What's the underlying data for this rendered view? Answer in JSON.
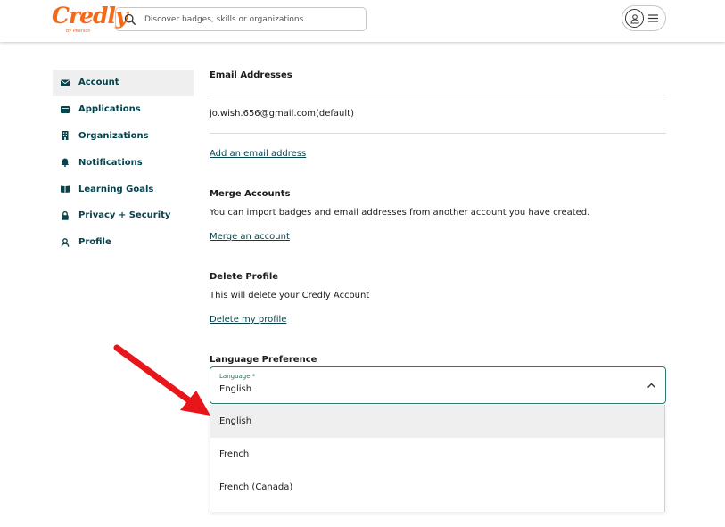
{
  "header": {
    "logo_text": "Credly",
    "logo_sub": "by Pearson",
    "search_placeholder": "Discover badges, skills or organizations"
  },
  "sidebar": {
    "items": [
      {
        "label": "Account",
        "icon": "envelope-icon",
        "active": true
      },
      {
        "label": "Applications",
        "icon": "window-icon"
      },
      {
        "label": "Organizations",
        "icon": "building-icon"
      },
      {
        "label": "Notifications",
        "icon": "bell-icon"
      },
      {
        "label": "Learning Goals",
        "icon": "book-icon"
      },
      {
        "label": "Privacy + Security",
        "icon": "lock-icon"
      },
      {
        "label": "Profile",
        "icon": "person-icon"
      }
    ]
  },
  "email": {
    "heading": "Email Addresses",
    "address": "jo.wish.656@gmail.com(default)",
    "add_link": "Add an email address"
  },
  "merge": {
    "heading": "Merge Accounts",
    "description": "You can import badges and email addresses from another account you have created.",
    "link": "Merge an account"
  },
  "delete": {
    "heading": "Delete Profile",
    "description": "This will delete your Credly Account",
    "link": "Delete my profile"
  },
  "language": {
    "heading": "Language Preference",
    "field_label": "Language *",
    "selected": "English",
    "options": [
      "English",
      "French",
      "French (Canada)"
    ]
  },
  "colors": {
    "brand_orange": "#f26b1d",
    "link_teal": "#06434a",
    "focus_border": "#2c7a6b",
    "annotation_red": "#e8151b"
  }
}
